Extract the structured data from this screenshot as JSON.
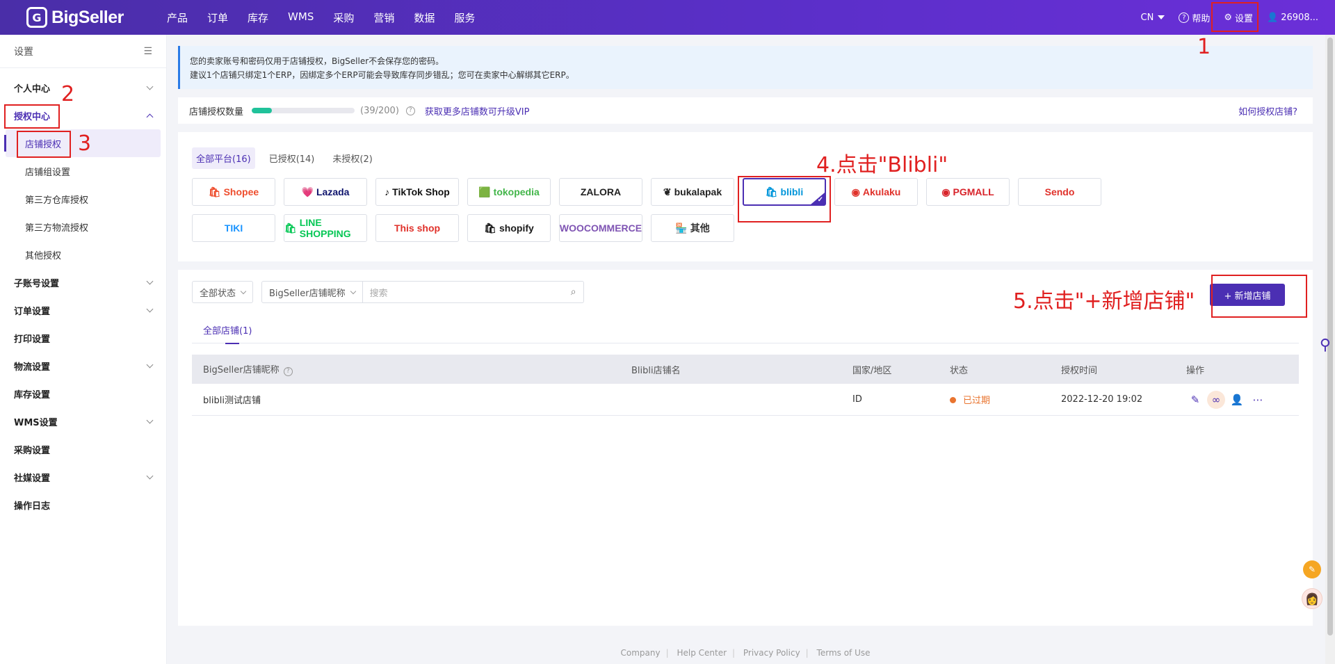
{
  "app": {
    "logo_mark": "G",
    "logo_text": "BigSeller"
  },
  "nav": [
    "产品",
    "订单",
    "库存",
    "WMS",
    "采购",
    "营销",
    "数据",
    "服务"
  ],
  "top_right": {
    "lang": "CN",
    "help": "帮助",
    "settings": "设置",
    "user": "26908..."
  },
  "sidebar": {
    "title": "设置",
    "items": [
      {
        "label": "个人中心"
      },
      {
        "label": "授权中心"
      },
      {
        "label": "店铺授权"
      },
      {
        "label": "店铺组设置"
      },
      {
        "label": "第三方仓库授权"
      },
      {
        "label": "第三方物流授权"
      },
      {
        "label": "其他授权"
      },
      {
        "label": "子账号设置"
      },
      {
        "label": "订单设置"
      },
      {
        "label": "打印设置"
      },
      {
        "label": "物流设置"
      },
      {
        "label": "库存设置"
      },
      {
        "label": "WMS设置"
      },
      {
        "label": "采购设置"
      },
      {
        "label": "社媒设置"
      },
      {
        "label": "操作日志"
      }
    ]
  },
  "notice": {
    "line1": "您的卖家账号和密码仅用于店铺授权，BigSeller不会保存您的密码。",
    "line2": "建议1个店铺只绑定1个ERP，因绑定多个ERP可能会导致库存同步错乱；您可在卖家中心解绑其它ERP。"
  },
  "quota": {
    "label": "店铺授权数量",
    "used": 39,
    "total": 200,
    "count_text": "(39/200)",
    "upgrade_link": "获取更多店铺数可升级VIP",
    "help_link": "如何授权店铺?"
  },
  "platform_tabs": [
    "全部平台(16)",
    "已授权(14)",
    "未授权(2)"
  ],
  "platforms": [
    {
      "name": "Shopee",
      "color": "#ee4d2d",
      "icon": "🛍"
    },
    {
      "name": "Lazada",
      "color": "#0f146d",
      "icon": "💗"
    },
    {
      "name": "TikTok Shop",
      "color": "#111111",
      "icon": "♪"
    },
    {
      "name": "tokopedia",
      "color": "#42b549",
      "icon": "🟩"
    },
    {
      "name": "ZALORA",
      "color": "#222222",
      "icon": ""
    },
    {
      "name": "bukalapak",
      "color": "#222222",
      "icon": "❦"
    },
    {
      "name": "blibli",
      "color": "#0095da",
      "icon": "🛍",
      "selected": true
    },
    {
      "name": "Akulaku",
      "color": "#e0312a",
      "icon": "◉"
    },
    {
      "name": "PGMALL",
      "color": "#d8232a",
      "icon": "◉"
    },
    {
      "name": "Sendo",
      "color": "#e0312a",
      "icon": ""
    },
    {
      "name": "TIKI",
      "color": "#1a94ff",
      "icon": ""
    },
    {
      "name": "LINE SHOPPING",
      "color": "#06c755",
      "icon": "🛍"
    },
    {
      "name": "This shop",
      "color": "#e0312a",
      "icon": ""
    },
    {
      "name": "shopify",
      "color": "#1a1a1a",
      "icon": "🛍"
    },
    {
      "name": "WOOCOMMERCE",
      "color": "#7f54b3",
      "icon": ""
    },
    {
      "name": "其他",
      "color": "#333333",
      "icon": "🏪"
    }
  ],
  "store_filters": {
    "status": "全部状态",
    "field": "BigSeller店铺昵称",
    "search_placeholder": "搜索",
    "add_button": "+ 新增店铺"
  },
  "store_tabs": [
    "全部店铺(1)"
  ],
  "table": {
    "headers": [
      "BigSeller店铺昵称",
      "Blibli店铺名",
      "国家/地区",
      "状态",
      "授权时间",
      "操作"
    ],
    "rows": [
      {
        "nickname": "blibli测试店铺",
        "store_name": "",
        "country": "ID",
        "status": "已过期",
        "time": "2022-12-20 19:02"
      }
    ]
  },
  "footer": [
    "Company",
    "Help Center",
    "Privacy Policy",
    "Terms of Use"
  ],
  "annotations": {
    "n1": "1",
    "n2": "2",
    "n3": "3",
    "n4": "4.点击\"Blibli\"",
    "n5": "5.点击\"+新增店铺\""
  },
  "colors": {
    "brand": "#4b2fb3",
    "annotation": "#e02020",
    "expired": "#e9742f"
  }
}
